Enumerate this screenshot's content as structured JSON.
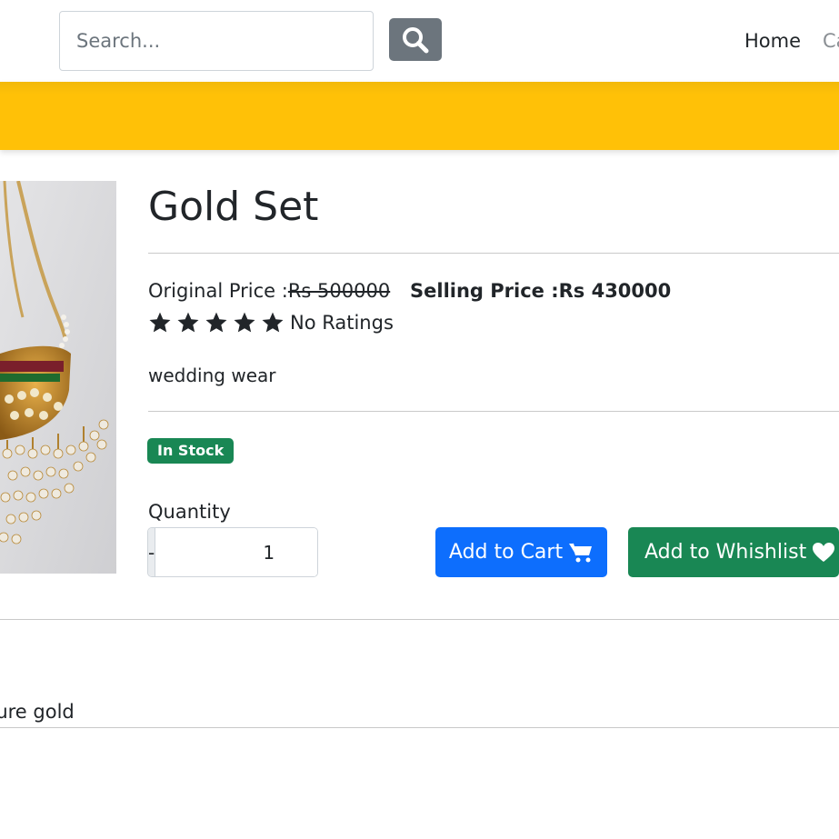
{
  "navbar": {
    "search_placeholder": "Search...",
    "search_button_icon": "search-icon",
    "links": [
      "Home",
      "Ca"
    ]
  },
  "colors": {
    "banner": "#ffc107",
    "search_button": "#6c757d",
    "cart_button": "#0d6efd",
    "wishlist_button": "#198754",
    "stock_badge": "#198754"
  },
  "product": {
    "image_icon": "necklace-image",
    "title": "Gold Set",
    "original_price_label": "Original Price :",
    "original_price": "Rs 500000",
    "selling_price": "Selling Price :Rs 430000",
    "star_count": 5,
    "ratings_text": "No Ratings",
    "description": "wedding wear",
    "stock_status": "In Stock",
    "quantity_label": "Quantity",
    "quantity_minus": "-",
    "quantity_value": "1",
    "quantity_plus": "+",
    "add_to_cart_label": "Add to Cart",
    "add_to_cart_icon": "cart-icon",
    "add_to_wishlist_label": "Add to Whishlist",
    "add_to_wishlist_icon": "heart-icon"
  },
  "details": {
    "text": "pure gold"
  }
}
